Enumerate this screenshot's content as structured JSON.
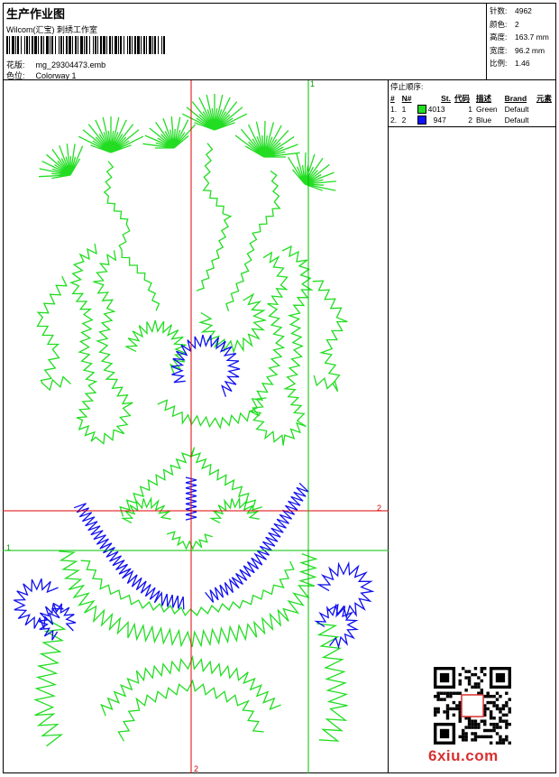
{
  "header": {
    "title": "生产作业图",
    "subtitle": "Wilcom(汇宝) 刺绣工作室",
    "pattern_label": "花版:",
    "pattern_value": "mg_29304473.emb",
    "colorway_label": "色位:",
    "colorway_value": "Colorway 1"
  },
  "stats": [
    {
      "label": "针数:",
      "value": "4962"
    },
    {
      "label": "颜色:",
      "value": "2"
    },
    {
      "label": "高度:",
      "value": "163.7 mm"
    },
    {
      "label": "宽度:",
      "value": "96.2 mm"
    },
    {
      "label": "比例:",
      "value": "1.46"
    }
  ],
  "stops": {
    "caption": "停止顺序:",
    "columns": [
      "#",
      "N#",
      "St.",
      "代码",
      "描述",
      "Brand",
      "元素"
    ],
    "rows": [
      {
        "num": "1.",
        "n": "1",
        "color": "#22dd22",
        "st": "4013",
        "code": "1",
        "desc": "Green",
        "brand": "Default",
        "elem": ""
      },
      {
        "num": "2.",
        "n": "2",
        "color": "#1010ff",
        "st": "947",
        "code": "2",
        "desc": "Blue",
        "brand": "Default",
        "elem": ""
      }
    ]
  },
  "axes": {
    "top_marker": "1",
    "left_marker": "1",
    "right_marker": "2",
    "bottom_marker": "2"
  },
  "colors": {
    "green_thread": "#22dd22",
    "blue_thread": "#1010ee",
    "axis_red": "#e00000",
    "axis_green": "#00c000"
  },
  "watermark": {
    "text": "6xiu.com"
  }
}
